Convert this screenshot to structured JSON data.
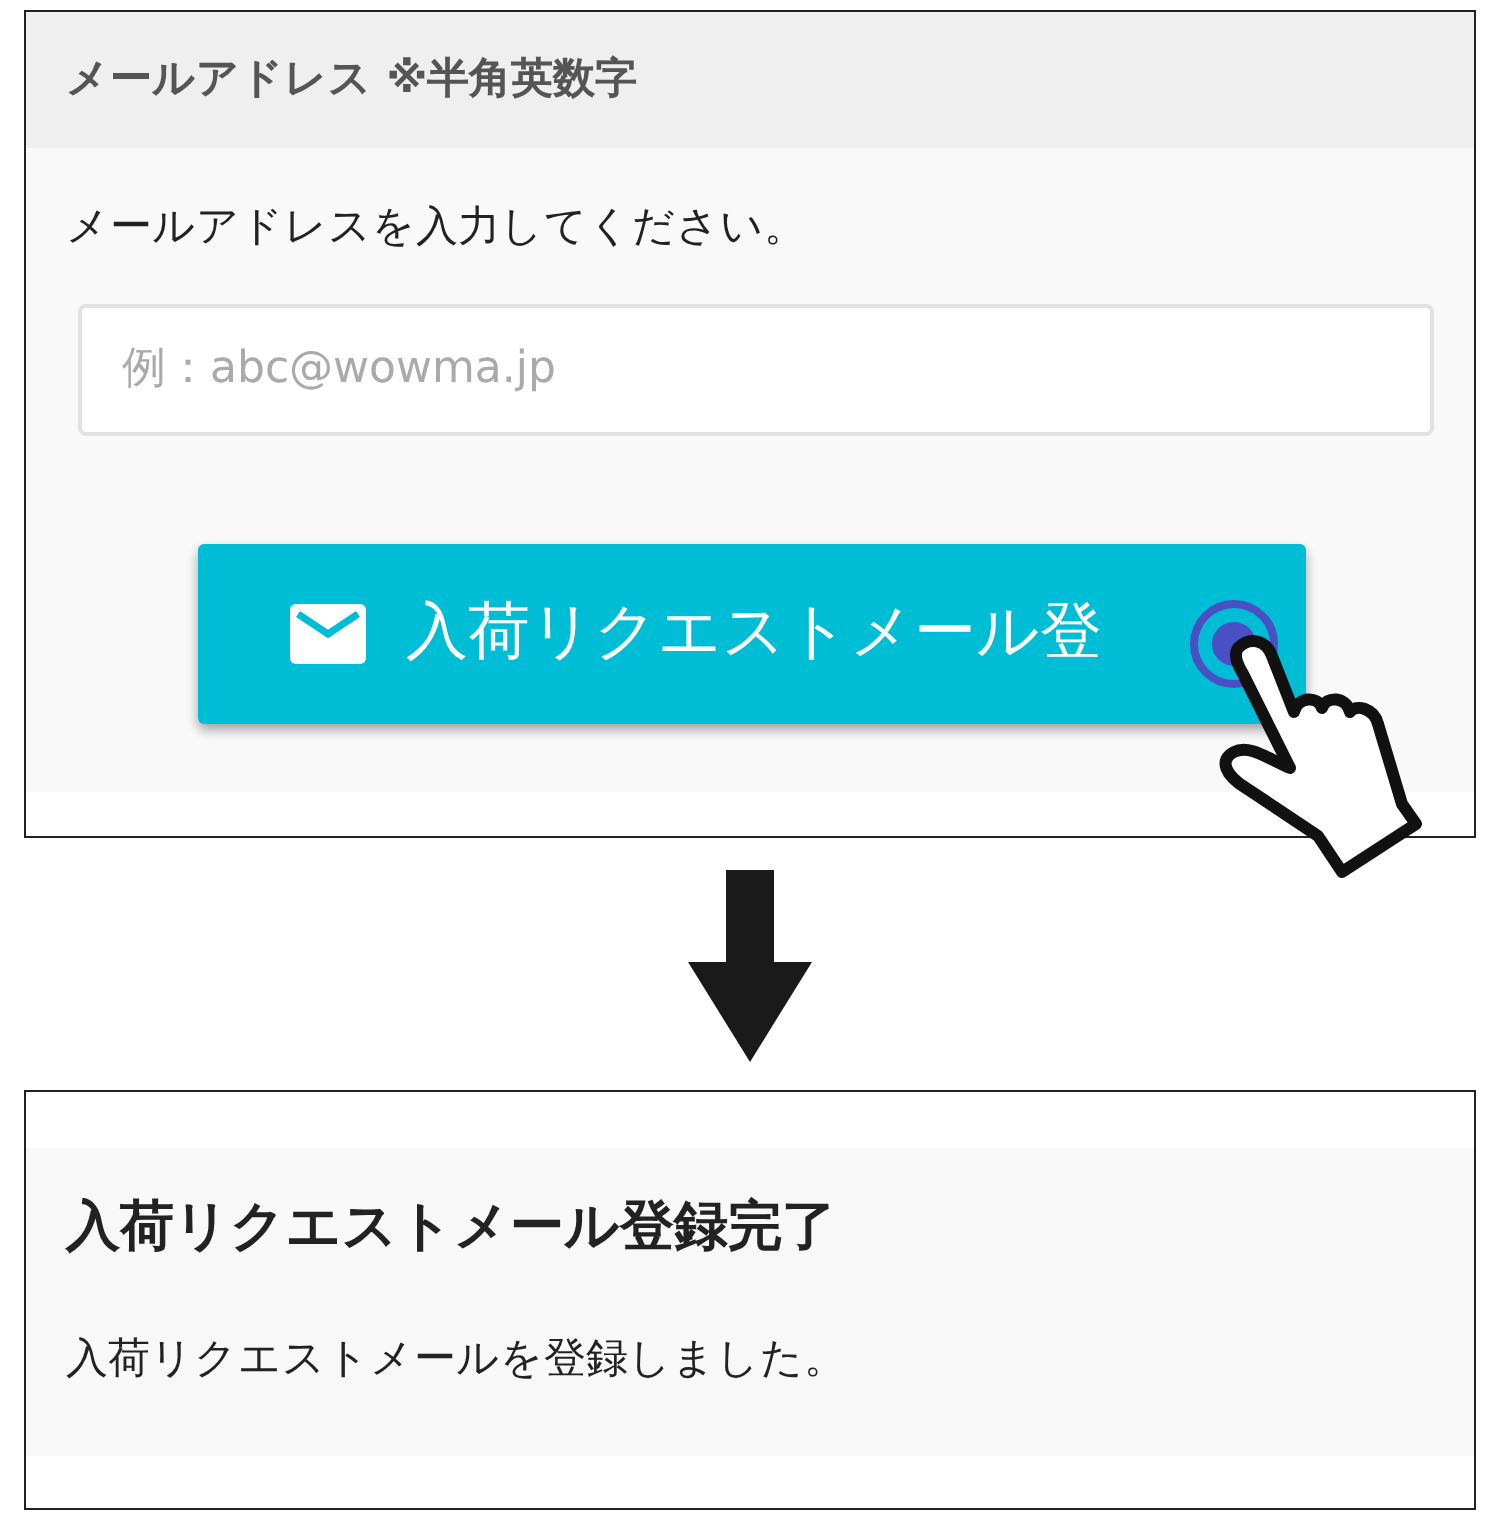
{
  "form": {
    "header": "メールアドレス ※半角英数字",
    "instruction": "メールアドレスを入力してください。",
    "email_field": {
      "placeholder": "例：abc@wowma.jp"
    },
    "submit_button": {
      "label": "入荷リクエストメール登"
    }
  },
  "result": {
    "title": "入荷リクエストメール登録完了",
    "message": "入荷リクエストメールを登録しました。"
  }
}
